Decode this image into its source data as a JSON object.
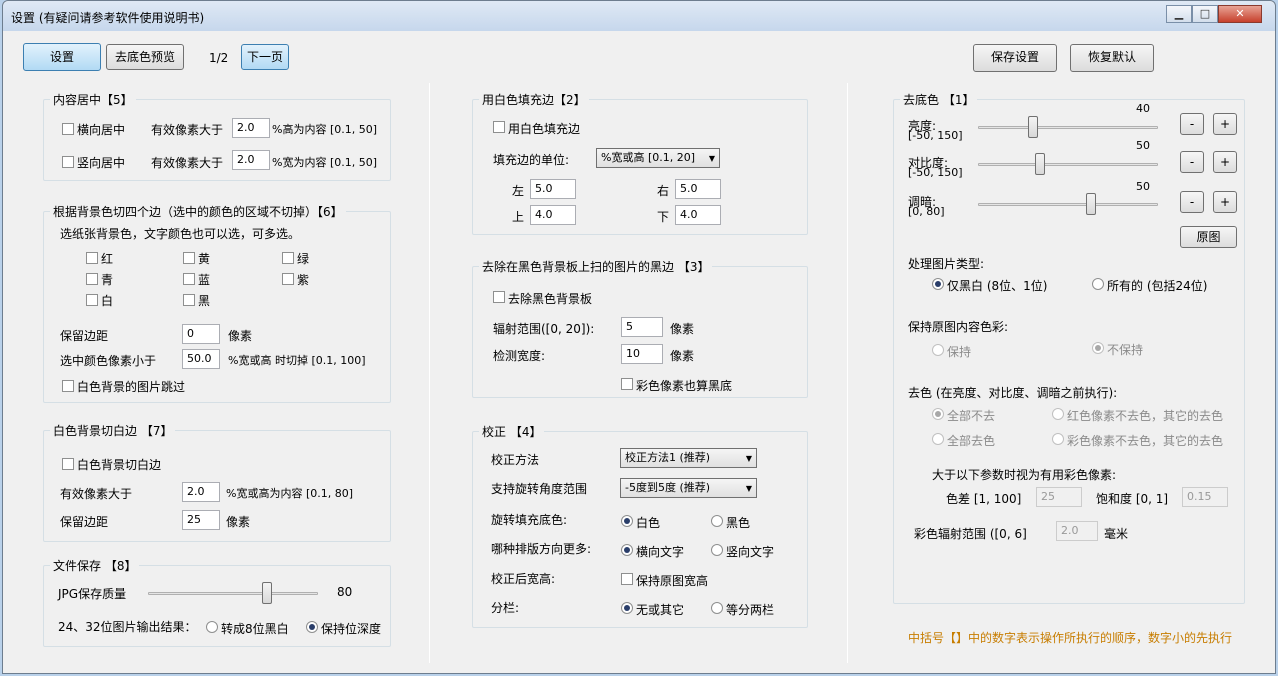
{
  "window": {
    "title": "设置 (有疑问请参考软件使用说明书)"
  },
  "toolbar": {
    "settings": "设置",
    "preview": "去底色预览",
    "page": "1/2",
    "next": "下一页",
    "save": "保存设置",
    "restore": "恢复默认"
  },
  "center": {
    "title": "内容居中【5】",
    "h_label": "横向居中",
    "v_label": "竖向居中",
    "eff": "有效像素大于",
    "h_val": "2.0",
    "v_val": "2.0",
    "h_suffix": "%高为内容 [0.1, 50]",
    "v_suffix": "%宽为内容 [0.1, 50]"
  },
  "cut4": {
    "title": "根据背景色切四个边（选中的颜色的区域不切掉）【6】",
    "desc": "选纸张背景色，文字颜色也可以选，可多选。",
    "colors": [
      "红",
      "黄",
      "绿",
      "青",
      "蓝",
      "紫",
      "白",
      "黑"
    ],
    "margin_label": "保留边距",
    "margin_val": "0",
    "margin_unit": "像素",
    "less_label": "选中颜色像素小于",
    "less_val": "50.0",
    "less_suffix": "%宽或高  时切掉 [0.1, 100]",
    "skip": "白色背景的图片跳过"
  },
  "white": {
    "title": "白色背景切白边 【7】",
    "label": "白色背景切白边",
    "eff": "有效像素大于",
    "eff_val": "2.0",
    "eff_suffix": "%宽或高为内容 [0.1, 80]",
    "margin_label": "保留边距",
    "margin_val": "25",
    "margin_unit": "像素"
  },
  "file": {
    "title": "文件保存 【8】",
    "jpg": "JPG保存质量",
    "jpg_val": "80",
    "jpg_quality": 80,
    "out": "24、32位图片输出结果：",
    "opt1": "转成8位黑白",
    "opt2": "保持位深度"
  },
  "fill": {
    "title": "用白色填充边【2】",
    "label": "用白色填充边",
    "unit_label": "填充边的单位:",
    "unit_val": "%宽或高 [0.1, 20]",
    "left": "左",
    "left_val": "5.0",
    "right": "右",
    "right_val": "5.0",
    "top": "上",
    "top_val": "4.0",
    "bottom": "下",
    "bottom_val": "4.0"
  },
  "black": {
    "title": "去除在黑色背景板上扫的图片的黑边 【3】",
    "label": "去除黑色背景板",
    "range_label": "辐射范围([0, 20]):",
    "range_val": "5",
    "range_unit": "像素",
    "width_label": "检测宽度:",
    "width_val": "10",
    "width_unit": "像素",
    "color": "彩色像素也算黑底"
  },
  "correct": {
    "title": "校正 【4】",
    "method_label": "校正方法",
    "method_val": "校正方法1 (推荐)",
    "angle_label": "支持旋转角度范围",
    "angle_val": "-5度到5度 (推荐)",
    "fill_label": "旋转填充底色:",
    "fill_white": "白色",
    "fill_black": "黑色",
    "dir_label": "哪种排版方向更多:",
    "dir_h": "横向文字",
    "dir_v": "竖向文字",
    "after_label": "校正后宽高:",
    "after_keep": "保持原图宽高",
    "col_label": "分栏:",
    "col_none": "无或其它",
    "col_two": "等分两栏"
  },
  "bg": {
    "title": "去底色 【1】",
    "bright_label": "亮度:",
    "bright_range": "[-50, 150]",
    "bright_val": "40",
    "bright": 40,
    "contrast_label": "对比度:",
    "contrast_range": "[-50, 150]",
    "contrast_val": "50",
    "contrast": 50,
    "dark_label": "调暗:",
    "dark_range": "[0, 80]",
    "dark_val": "50",
    "dark": 50,
    "minus": "-",
    "plus": "+",
    "orig": "原图",
    "type_label": "处理图片类型:",
    "type_bw": "仅黑白 (8位、1位)",
    "type_all": "所有的 (包括24位)",
    "keep_label": "保持原图内容色彩:",
    "keep": "保持",
    "nokeep": "不保持",
    "decolor_label": "去色 (在亮度、对比度、调暗之前执行):",
    "all_no": "全部不去",
    "red_no": "红色像素不去色，其它的去色",
    "all_yes": "全部去色",
    "color_no": "彩色像素不去色，其它的去色",
    "param_label": "大于以下参数时视为有用彩色像素:",
    "diff_label": "色差 [1, 100]",
    "diff_val": "25",
    "sat_label": "饱和度 [0, 1]",
    "sat_val": "0.15",
    "rad_label": "彩色辐射范围 ([0, 6]",
    "rad_val": "2.0",
    "rad_unit": "毫米"
  },
  "note": "中括号【】中的数字表示操作所执行的顺序，数字小的先执行",
  "icons": {
    "minimize": "minimize-icon",
    "maximize": "maximize-icon",
    "close": "close-icon"
  }
}
